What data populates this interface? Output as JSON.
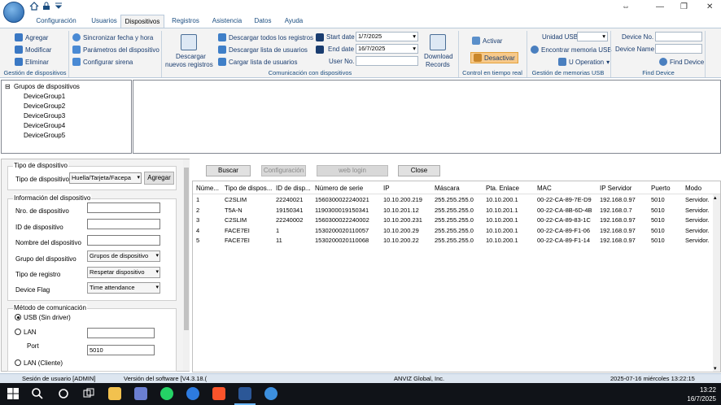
{
  "tabs": [
    "Configuración",
    "Usuarios",
    "Dispositivos",
    "Registros",
    "Asistencia",
    "Datos",
    "Ayuda"
  ],
  "ribbon": {
    "devices": {
      "add": "Agregar",
      "modify": "Modificar",
      "delete": "Eliminar",
      "label": "Gestión de dispositivos"
    },
    "sync": {
      "sync_time": "Sincronizar fecha y hora",
      "params": "Parámetros del dispositivo",
      "siren": "Configurar sirena"
    },
    "download_new_line1": "Descargar",
    "download_new_line2": "nuevos registros",
    "download_all": "Descargar todos los registros",
    "download_list": "Descargar lista de usuarios",
    "upload_list": "Cargar lista de usuarios",
    "start_date_label": "Start date",
    "start_date": "1/7/2025",
    "end_date_label": "End date",
    "end_date": "16/7/2025",
    "user_no_label": "User No.",
    "user_no": "",
    "download_records_line1": "Download",
    "download_records_line2": "Records",
    "comm_label": "Comunicación con dispositivos",
    "activate": "Activar",
    "deactivate": "Desactivar",
    "realtime_label": "Control en tiempo real",
    "usb_unit_label": "Unidad USB",
    "usb_unit": "",
    "find_usb": "Encontrar memoria USB",
    "u_operation": "U Operation",
    "usb_label": "Gestión de memorias USB",
    "device_no_label": "Device No.",
    "device_no": "",
    "device_name_label": "Device Name",
    "device_name": "",
    "find_device": "Find Device",
    "find_device_label": "Find Device"
  },
  "tree": {
    "root": "Grupos de dispositivos",
    "children": [
      "DeviceGroup1",
      "DeviceGroup2",
      "DeviceGroup3",
      "DeviceGroup4",
      "DeviceGroup5"
    ]
  },
  "form": {
    "device_type_group": "Tipo de dispositivo",
    "device_type_label": "Tipo de dispositivo",
    "device_type_value": "Huella/Tarjeta/Facepa",
    "add_button": "Agregar",
    "info_group": "Información del dispositivo",
    "device_no_label": "Nro. de dispositivo",
    "device_id_label": "ID de dispositivo",
    "device_name_label": "Nombre del dispositivo",
    "device_group_label": "Grupo del dispositivo",
    "device_group_value": "Grupos de dispositivo",
    "record_type_label": "Tipo de registro",
    "record_type_value": "Respetar dispositivo",
    "device_flag_label": "Device Flag",
    "device_flag_value": "Time attendance",
    "comm_group": "Método de comunicación",
    "usb_option": "USB (Sin driver)",
    "lan_option": "LAN",
    "port_label": "Port",
    "port_value": "5010",
    "lan_client_option": "LAN (Cliente)"
  },
  "actions": {
    "search": "Buscar",
    "config": "Configuración",
    "weblogin": "web login",
    "close": "Close"
  },
  "table": {
    "columns": [
      "Núme...",
      "Tipo de dispos...",
      "ID de disp...",
      "Número de serie",
      "IP",
      "Máscara",
      "Pta. Enlace",
      "MAC",
      "IP Servidor",
      "Puerto",
      "Modo"
    ],
    "rows": [
      [
        "1",
        "C2SLIM",
        "22240021",
        "1560300022240021",
        "10.10.200.219",
        "255.255.255.0",
        "10.10.200.1",
        "00-22-CA-89-7E-D9",
        "192.168.0.97",
        "5010",
        "Servidor."
      ],
      [
        "2",
        "T5A-N",
        "19150341",
        "1190300019150341",
        "10.10.201.12",
        "255.255.255.0",
        "10.10.201.1",
        "00-22-CA-8B-6D-4B",
        "192.168.0.7",
        "5010",
        "Servidor."
      ],
      [
        "3",
        "C2SLIM",
        "22240002",
        "1560300022240002",
        "10.10.200.231",
        "255.255.255.0",
        "10.10.200.1",
        "00-22-CA-89-83-1C",
        "192.168.0.97",
        "5010",
        "Servidor."
      ],
      [
        "4",
        "FACE7EI",
        "1",
        "1530200020110057",
        "10.10.200.29",
        "255.255.255.0",
        "10.10.200.1",
        "00-22-CA-89-F1-06",
        "192.168.0.97",
        "5010",
        "Servidor."
      ],
      [
        "5",
        "FACE7EI",
        "11",
        "1530200020110068",
        "10.10.200.22",
        "255.255.255.0",
        "10.10.200.1",
        "00-22-CA-89-F1-14",
        "192.168.0.97",
        "5010",
        "Servidor."
      ]
    ]
  },
  "status": {
    "session": "Sesión de usuario  [ADMIN]",
    "version": "Versión del software  [V4.3.18.(",
    "company": "ANVIZ Global, Inc.",
    "datetime": "2025-07-16 miércoles 13:22:15"
  },
  "taskbar": {
    "time": "13:22",
    "date": "16/7/2025"
  },
  "colors": {
    "ribbon_bg": "#f3f3f3",
    "accent_text": "#1a4d80",
    "taskbar": "#101318",
    "deactivate_bg": "#f7c98a"
  }
}
